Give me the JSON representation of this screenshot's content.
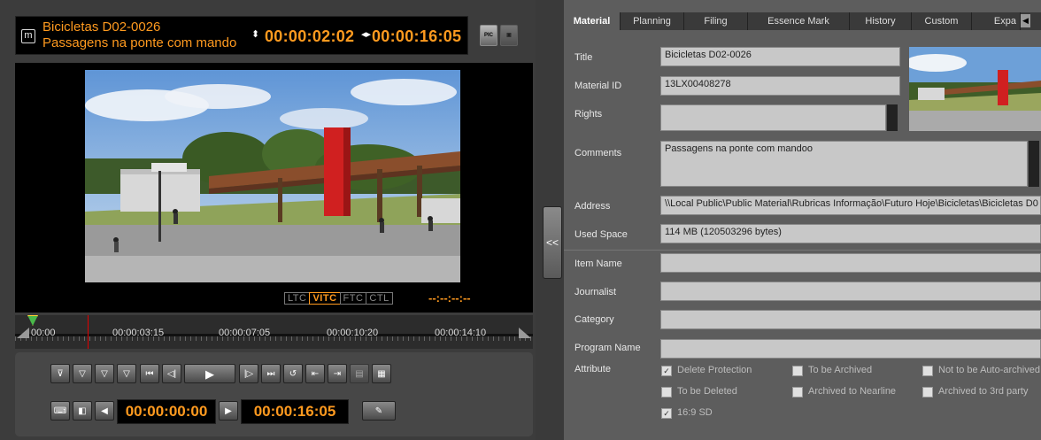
{
  "player": {
    "clip_title": "Bicicletas D02-0026",
    "clip_subtitle": "Passagens na ponte com mandoo",
    "mode_icon": "m",
    "current_timecode": "00:00:02:02",
    "duration_timecode": "00:00:16:05",
    "pic_button_label": "PIC",
    "timecode_modes": [
      "LTC",
      "VITC",
      "FTC",
      "CTL"
    ],
    "active_timecode_mode": "VITC",
    "vitc_readout": "--:--:--:--",
    "timeline_labels": [
      "00:00",
      "00:00:03:15",
      "00:00:07:05",
      "00:00:10:20",
      "00:00:14:10"
    ],
    "playhead_fraction": 0.14,
    "in_point_timecode": "00:00:00:00",
    "out_point_timecode": "00:00:16:05",
    "collapse_label": "<<"
  },
  "tabs": [
    "Material",
    "Planning",
    "Filing",
    "Essence Mark",
    "History",
    "Custom",
    "Expa"
  ],
  "active_tab": "Material",
  "metadata": {
    "title_label": "Title",
    "title_value": "Bicicletas D02-0026",
    "material_id_label": "Material ID",
    "material_id_value": "13LX00408278",
    "rights_label": "Rights",
    "rights_value": "",
    "comments_label": "Comments",
    "comments_value": "Passagens na ponte com mandoo",
    "address_label": "Address",
    "address_value": "\\\\Local Public\\Public Material\\Rubricas Informação\\Futuro Hoje\\Bicicletas\\Bicicletas D0",
    "used_space_label": "Used Space",
    "used_space_value": "114 MB (120503296 bytes)",
    "item_name_label": "Item Name",
    "journalist_label": "Journalist",
    "category_label": "Category",
    "program_name_label": "Program Name",
    "attribute_label": "Attribute"
  },
  "attributes": [
    {
      "label": "Delete Protection",
      "checked": true
    },
    {
      "label": "To be Archived",
      "checked": false
    },
    {
      "label": "Not to be Auto-archived",
      "checked": false
    },
    {
      "label": "To be Deleted",
      "checked": false
    },
    {
      "label": "Archived to Nearline",
      "checked": false
    },
    {
      "label": "Archived to 3rd party",
      "checked": false
    },
    {
      "label": "16:9 SD",
      "checked": true
    }
  ],
  "colors": {
    "accent": "#ff9a1f",
    "panel": "#5d5d5d",
    "field": "#c8c8c8",
    "playhead": "#e00000"
  }
}
